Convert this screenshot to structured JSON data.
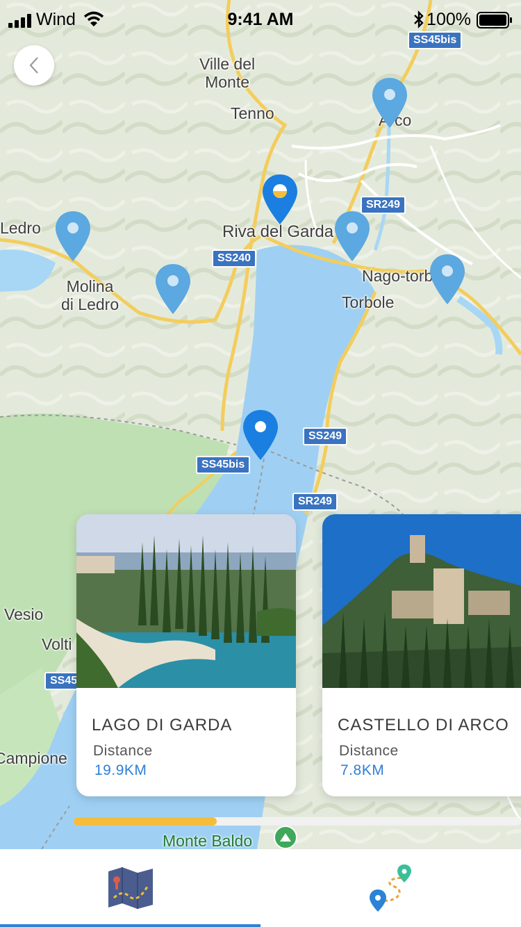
{
  "status_bar": {
    "carrier": "Wind",
    "time": "9:41 AM",
    "battery": "100%"
  },
  "map": {
    "labels": {
      "ville_del_monte": "Ville del\nMonte",
      "tenno": "Tenno",
      "arco": "Arco",
      "ledro": "Ledro",
      "riva_del_garda": "Riva del Garda",
      "molina_di_ledro": "Molina\ndi Ledro",
      "nago_torbole": "Nago-torbole",
      "torbole": "Torbole",
      "vesio": "Vesio",
      "volti": "Volti",
      "campione": "Campione",
      "monte_baldo": "Monte Baldo"
    },
    "road_shields": {
      "ss45bis_top": "SS45bis",
      "sr249_top": "SR249",
      "ss240": "SS240",
      "ss249": "SS249",
      "ss45bis_mid": "SS45bis",
      "sr249_mid": "SR249",
      "ss45_left": "SS45"
    }
  },
  "cards": [
    {
      "title": "LAGO DI GARDA",
      "distance_label": "Distance",
      "distance": "19.9KM"
    },
    {
      "title": "CASTELLO DI ARCO",
      "distance_label": "Distance",
      "distance": "7.8KM"
    }
  ],
  "carousel_progress": 0.32,
  "tabs": [
    {
      "icon": "folded-map-icon",
      "active": true
    },
    {
      "icon": "route-icon",
      "active": false
    }
  ],
  "colors": {
    "accent_blue": "#2c83d6",
    "pin_light": "#5ca8e0",
    "pin_active": "#1a7fe0",
    "progress": "#f5bd3b"
  }
}
